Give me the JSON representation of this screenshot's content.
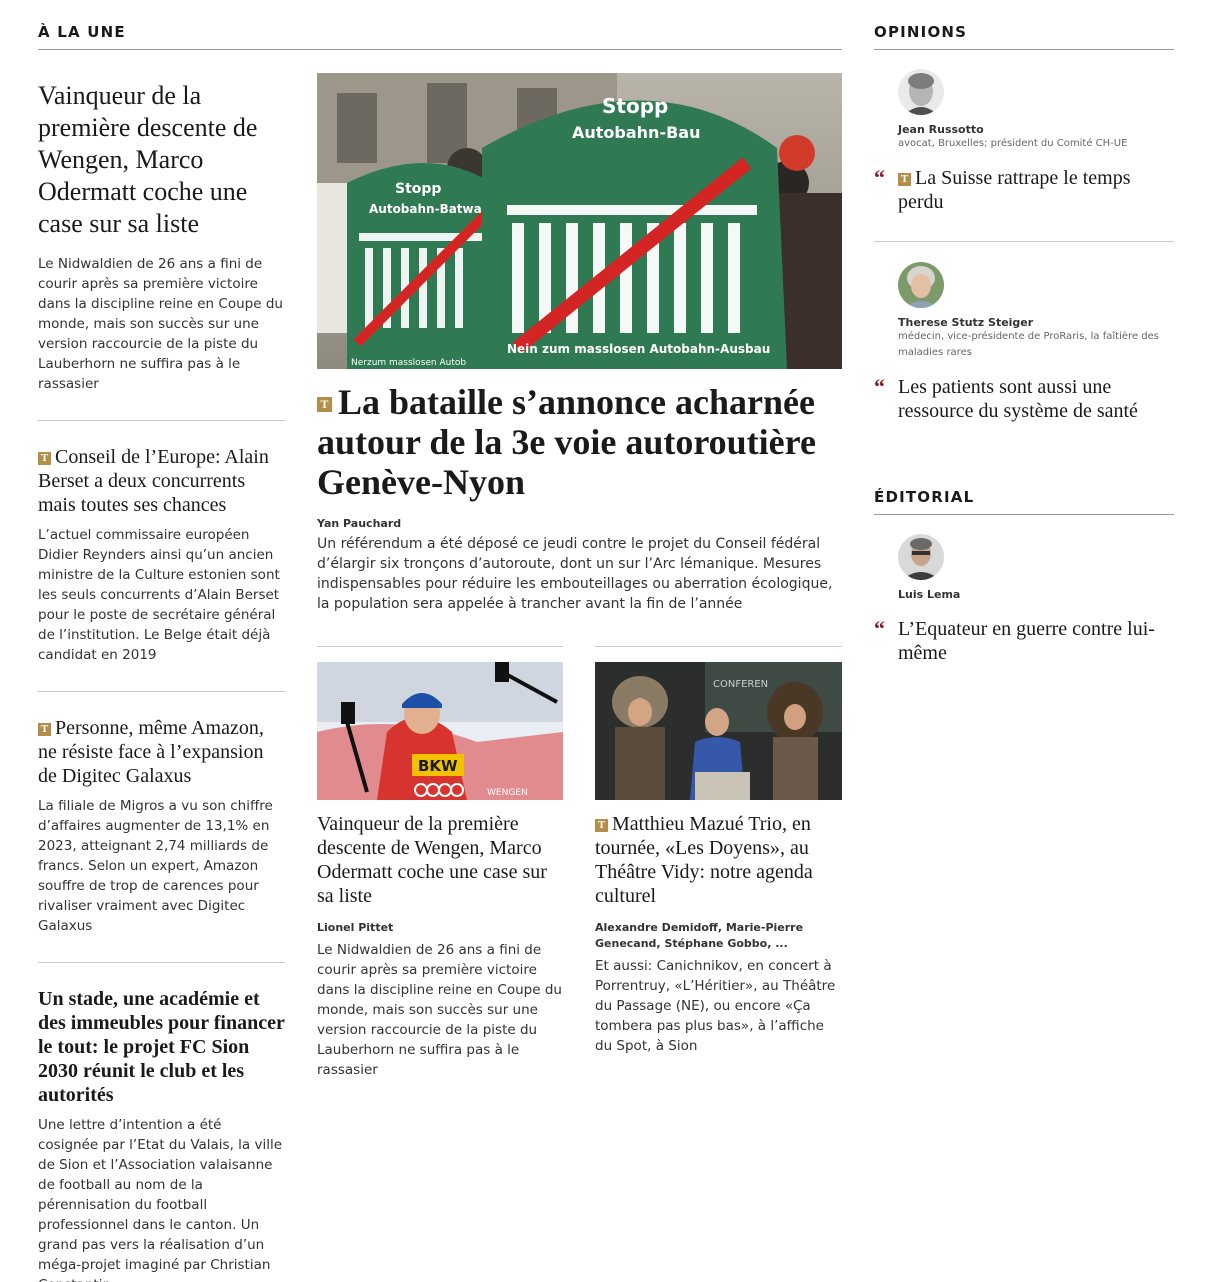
{
  "sections": {
    "a_la_une": "À LA UNE",
    "opinions": "OPINIONS",
    "editorial": "ÉDITORIAL"
  },
  "left_articles": [
    {
      "title": "Vainqueur de la première descente de Wengen, Marco Odermatt coche une case sur sa liste",
      "lead": "Le Nidwaldien de 26 ans a fini de courir après sa première victoire dans la discipline reine en Coupe du monde, mais son succès sur une version raccourcie de la piste du Lauberhorn ne suffira pas à le rassasier"
    },
    {
      "badge": "T",
      "title": "Conseil de l’Europe: Alain Berset a deux concurrents mais toutes ses chances",
      "lead": "L’actuel commissaire européen Didier Reynders ainsi qu’un ancien ministre de la Culture estonien sont les seuls concurrents d’Alain Berset pour le poste de secrétaire général de l’institution. Le Belge était déjà candidat en 2019"
    },
    {
      "badge": "T",
      "title": "Personne, même Amazon, ne résiste face à l’expansion de Digitec Galaxus",
      "lead": "La filiale de Migros a vu son chiffre d’affaires augmenter de 13,1% en 2023, atteignant 2,74 milliards de francs. Selon un expert, Amazon souffre de trop de carences pour rivaliser vraiment avec Digitec Galaxus"
    },
    {
      "title": "Un stade, une académie et des immeubles pour financer le tout: le projet FC Sion 2030 réunit le club et les autorités",
      "lead": "Une lettre d’intention a été cosignée par l’Etat du Valais, la ville de Sion et l’Association valaisanne de football au nom de la pérennisation du football professionnel dans le canton. Un grand pas vers la réalisation d’un méga-projet imaginé par Christian Constantin"
    }
  ],
  "main": {
    "badge": "T",
    "title": "La bataille s’annonce acharnée autour de la 3e voie autoroutière Genève-Nyon",
    "author": "Yan Pauchard",
    "lead": "Un référendum a été déposé ce jeudi contre le projet du Conseil fédéral d’élargir six tronçons d’autoroute, dont un sur l’Arc lémanique. Mesures indispensables pour réduire les embouteillages ou aberration écologique, la population sera appelée à trancher avant la fin de l’année",
    "image": {
      "banner_top": "Stopp",
      "banner_top2": "Autobahn-Bau",
      "banner_left": "Stopp",
      "banner_left2": "Autobahn-Batwa",
      "banner_bottom": "Nein zum masslosen Autobahn-Ausbau",
      "banner_bottom_left": "Nerzum masslosen Autob"
    }
  },
  "sub_articles": [
    {
      "title": "Vainqueur de la première descente de Wengen, Marco Odermatt coche une case sur sa liste",
      "author": "Lionel Pittet",
      "lead": "Le Nidwaldien de 26 ans a fini de courir après sa première victoire dans la discipline reine en Coupe du monde, mais son succès sur une version raccourcie de la piste du Lauberhorn ne suffira pas à le rassasier",
      "image": {
        "sponsor": "BKW",
        "place": "WENGEN"
      }
    },
    {
      "badge": "T",
      "title": "Matthieu Mazué Trio, en tournée, «Les Doyens», au Théâtre Vidy: notre agenda culturel",
      "author": "Alexandre Demidoff, Marie-Pierre Genecand, Stéphane Gobbo, ...",
      "lead": "Et aussi: Canichnikov, en concert à Porrentruy, «L’Héritier», au Théâtre du Passage (NE), ou encore «Ça tombera pas plus bas», à l’affiche du Spot, à Sion",
      "image": {
        "board": "CONFEREN"
      }
    }
  ],
  "opinions": [
    {
      "name": "Jean Russotto",
      "role": "avocat, Bruxelles; président du Comité CH-UE",
      "badge": "T",
      "title": "La Suisse rattrape le temps perdu"
    },
    {
      "name": "Therese Stutz Steiger",
      "role": "médecin, vice-présidente de ProRaris, la faîtière des maladies rares",
      "title": "Les patients sont aussi une ressource du système de santé"
    }
  ],
  "editorial": {
    "name": "Luis Lema",
    "title": "L’Equateur en guerre contre lui-même"
  },
  "quote_mark": "“",
  "colors": {
    "badge": "#b38d4a",
    "quote": "#8c1c24",
    "banner_green": "#2f7a52"
  }
}
